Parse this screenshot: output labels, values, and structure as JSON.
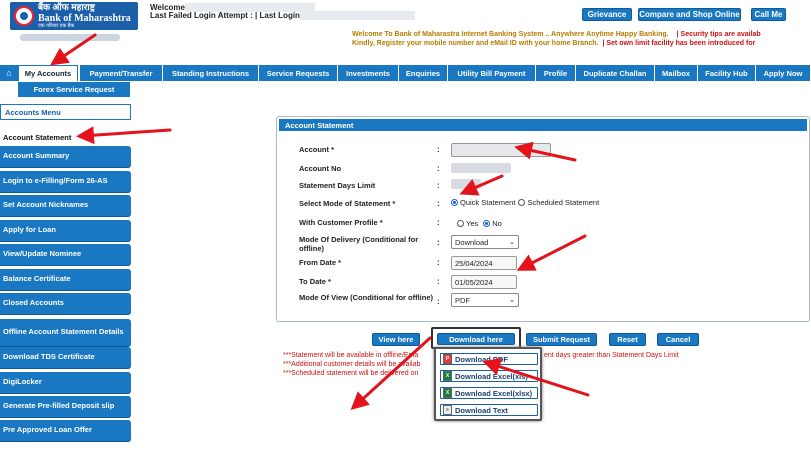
{
  "header": {
    "logo_hindi": "बैंक ऑफ महाराष्ट्र",
    "logo_english": "Bank of Maharashtra",
    "logo_tagline": "एक परिवार एक बैंक",
    "welcome": "Welcome,",
    "login_info": "Last Failed Login Attempt : | Last Login",
    "buttons": [
      "Grievance",
      "Compare and Shop Online",
      "Call Me"
    ],
    "marquee_line1": "Welcome To Bank of Maharastra Internet Banking System .. Anywhere Anytime Happy Banking.",
    "marquee_line1_sec": "|  Security tips are availab",
    "marquee_line2": "Kindly, Register your mobile number and eMail ID with your home Branch.",
    "marquee_line2_sec": "|  Set own limit facility has been introduced for"
  },
  "nav": {
    "home_icon": "home-icon",
    "tabs": [
      "My Accounts",
      "Payment/Transfer",
      "Standing Instructions",
      "Service Requests",
      "Investments",
      "Enquiries",
      "Utility Bill Payment",
      "Profile",
      "Duplicate Challan",
      "Mailbox",
      "Facility Hub",
      "Apply Now"
    ],
    "subtab": "Forex Service Request"
  },
  "sidebar": {
    "title": "Accounts Menu",
    "items": [
      "Account Statement",
      "Account Summary",
      "Login to e-Filling/Form 26-AS",
      "Set Account Nicknames",
      "Apply for Loan",
      "View/Update Nominee",
      "Balance Certificate",
      "Closed Accounts",
      "Offline Account Statement Details",
      "Download TDS Certificate",
      "DigiLocker",
      "Generate Pre-filled Deposit slip",
      "Pre Approved Loan Offer"
    ]
  },
  "form": {
    "title": "Account Statement",
    "labels": {
      "account": "Account *",
      "account_no": "Account No",
      "days_limit": "Statement Days Limit",
      "mode": "Select Mode of Statement *",
      "profile": "With Customer Profile *",
      "delivery": "Mode Of Delivery (Conditional for offline)",
      "from": "From Date *",
      "to": "To Date *",
      "view": "Mode Of View (Conditional for offline)"
    },
    "colon": ":",
    "mode_options": [
      "Quick Statement",
      "Scheduled Statement"
    ],
    "profile_options": [
      "Yes",
      "No"
    ],
    "delivery_value": "Download",
    "from_date": "25/04/2024",
    "to_date": "01/05/2024",
    "view_value": "PDF"
  },
  "actions": {
    "view": "View here",
    "download": "Download here",
    "submit": "Submit Request",
    "reset": "Reset",
    "cancel": "Cancel"
  },
  "notes": {
    "line1": "***Statement will be available in offline/Ema",
    "line2": "***Additional customer details will be availab",
    "line3": "***Scheduled statement will be delivered on",
    "line1_right": "ent days greater than Statement Days Limit"
  },
  "download_menu": [
    "Download PDF",
    "Download Excel(xls)",
    "Download Excel(xlsx)",
    "Download Text"
  ],
  "colors": {
    "primary": "#1a78c2",
    "arrow": "#e3121b",
    "note": "#c11111"
  }
}
